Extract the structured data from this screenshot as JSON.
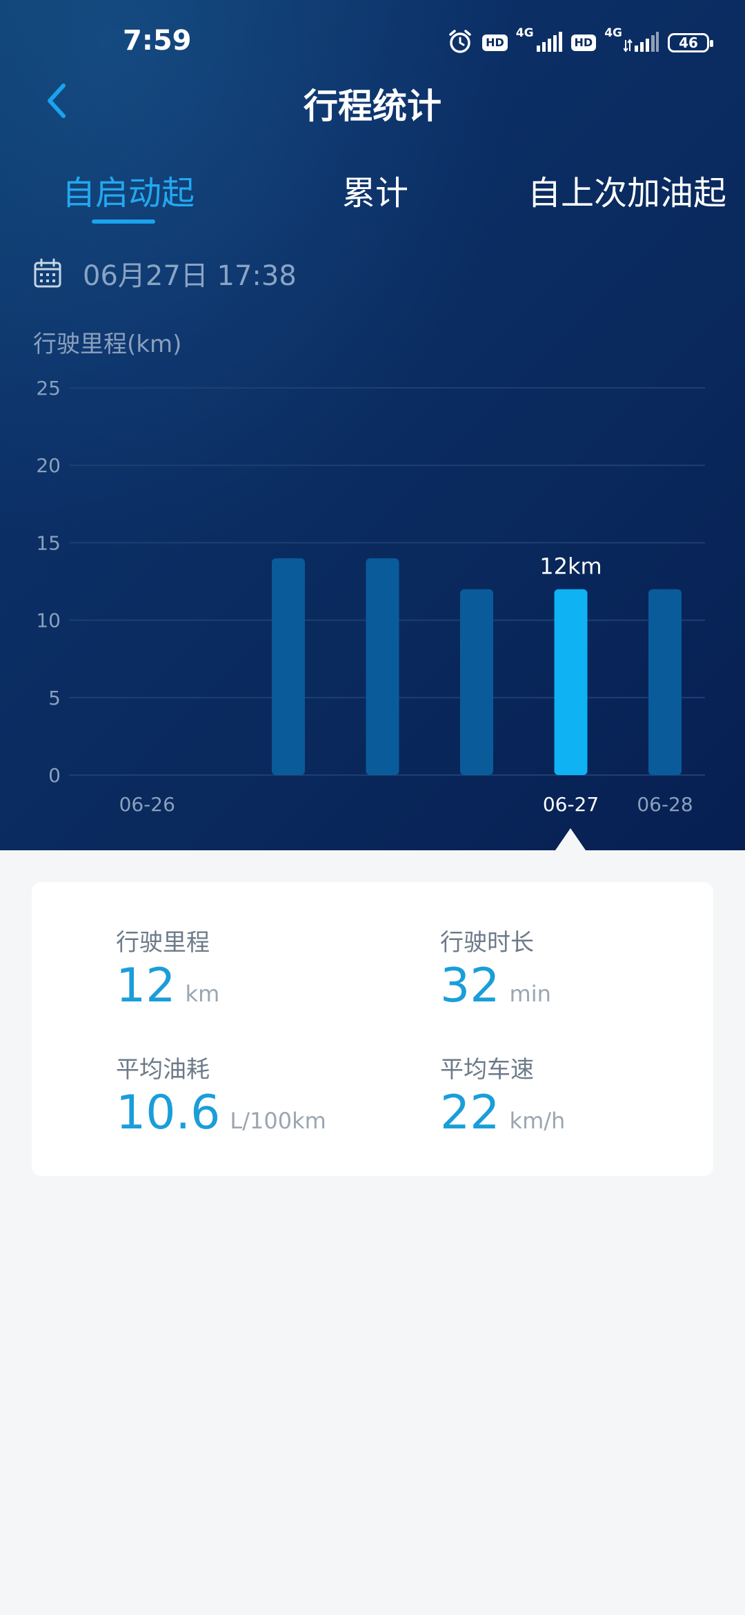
{
  "status_bar": {
    "time": "7:59",
    "hd_label": "HD",
    "network_label": "4G",
    "battery": "46"
  },
  "header": {
    "title": "行程统计"
  },
  "tabs": [
    {
      "label": "自启动起",
      "active": true
    },
    {
      "label": "累计",
      "active": false
    },
    {
      "label": "自上次加油起",
      "active": false
    }
  ],
  "date": {
    "text": "06月27日 17:38"
  },
  "chart_data": {
    "type": "bar",
    "ylabel": "行驶里程(km)",
    "ylim": [
      0,
      25
    ],
    "yticks": [
      "25",
      "20",
      "15",
      "10",
      "5",
      "0"
    ],
    "values": [
      0,
      0,
      14,
      14,
      12,
      12,
      12
    ],
    "selected_index": 5,
    "selected_label": "12km",
    "x_tick_labels": [
      {
        "index": 0.5,
        "label": "06-26"
      },
      {
        "index": 5,
        "label": "06-27"
      },
      {
        "index": 6,
        "label": "06-28"
      }
    ],
    "grid": true,
    "colors": {
      "bar": "#0a5b9a",
      "bar_selected": "#0fb2f2",
      "grid": "#1e3f72",
      "tick": "#8aa0bd"
    }
  },
  "stats": {
    "distance": {
      "label": "行驶里程",
      "value": "12",
      "unit": "km"
    },
    "duration": {
      "label": "行驶时长",
      "value": "32",
      "unit": "min"
    },
    "fuel": {
      "label": "平均油耗",
      "value": "10.6",
      "unit": "L/100km"
    },
    "speed": {
      "label": "平均车速",
      "value": "22",
      "unit": "km/h"
    }
  }
}
